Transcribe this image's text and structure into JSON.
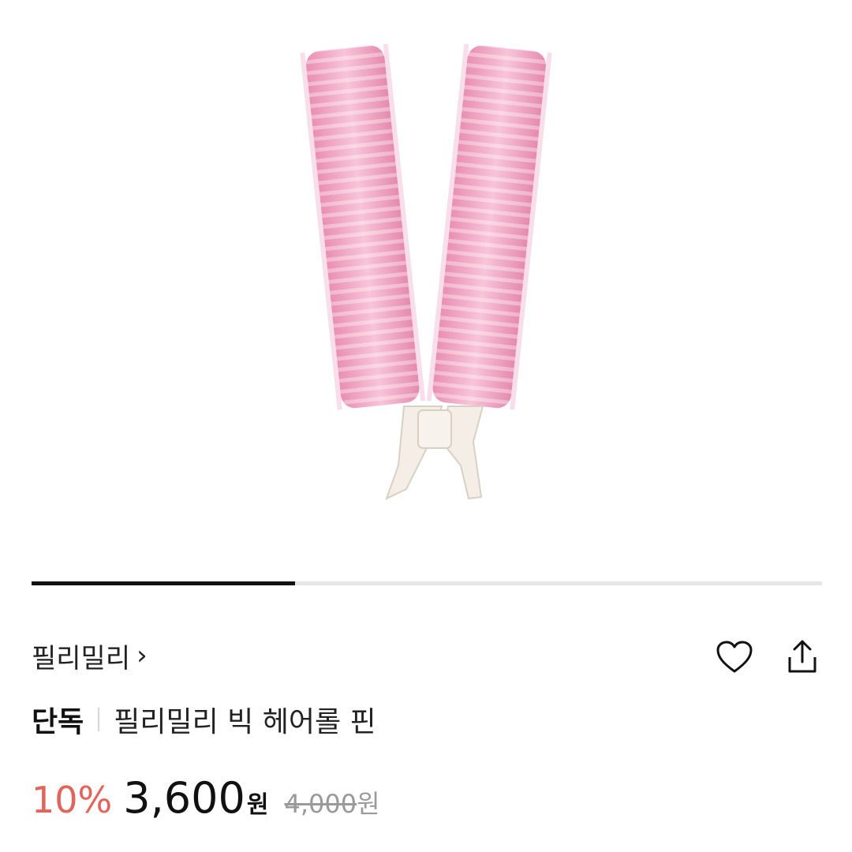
{
  "product": {
    "brand_label": "필리밀리",
    "brand_chevron": "›",
    "tag": "단독",
    "title": "필리밀리 빅 헤어롤 핀",
    "discount": "10%",
    "price": "3,600",
    "price_unit": "원",
    "original_price": "4,000",
    "original_unit": "원"
  },
  "gallery": {
    "progress_fraction": 0.333
  },
  "icons": {
    "wishlist": "heart-icon",
    "share": "share-icon"
  },
  "colors": {
    "discount": "#e2645a",
    "roller_pink": "#f2a7c3",
    "progress_active": "#111111",
    "progress_track": "#e6e6e6"
  }
}
